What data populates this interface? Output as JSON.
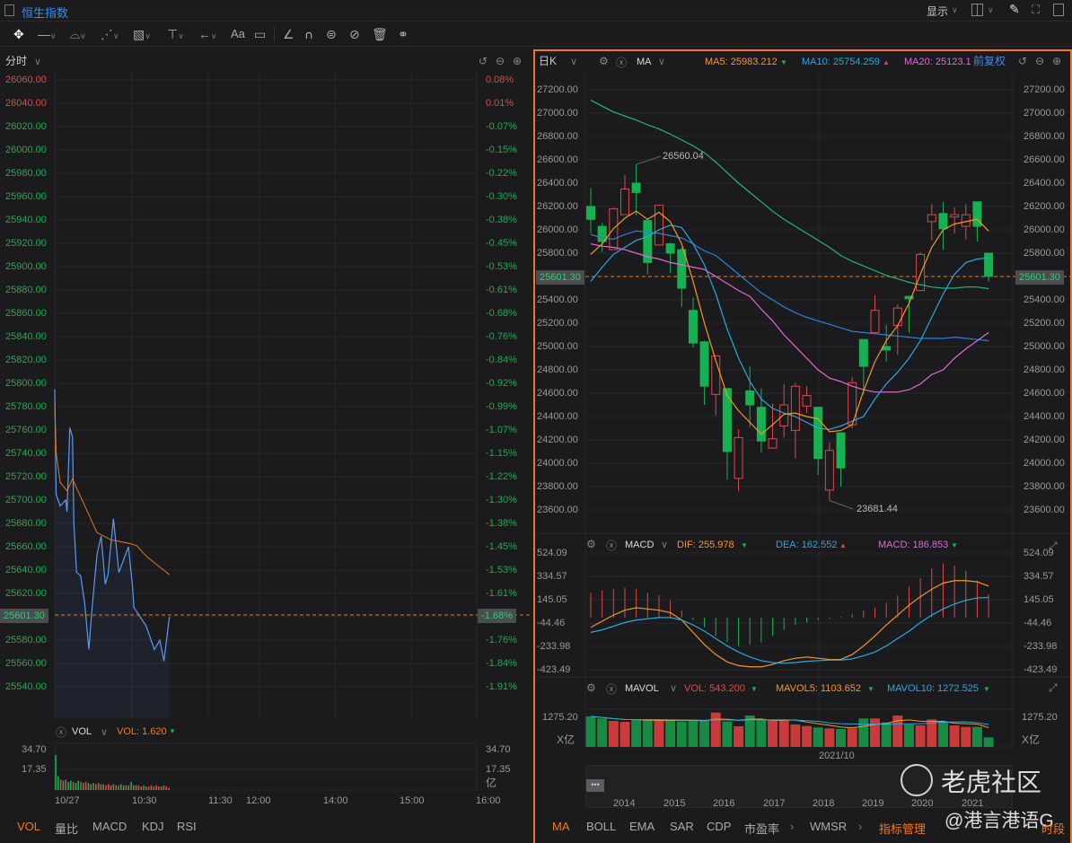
{
  "header": {
    "title": "恒生指数",
    "display_label": "显示"
  },
  "toolbar": {
    "text_tool": "Aa"
  },
  "left": {
    "period": "分时",
    "price_labels": [
      "26060.00",
      "26040.00",
      "26020.00",
      "26000.00",
      "25980.00",
      "25960.00",
      "25940.00",
      "25920.00",
      "25900.00",
      "25880.00",
      "25860.00",
      "25840.00",
      "25820.00",
      "25800.00",
      "25780.00",
      "25760.00",
      "25740.00",
      "25720.00",
      "25700.00",
      "25680.00",
      "25660.00",
      "25640.00",
      "25620.00",
      "",
      "25580.00",
      "25560.00",
      "25540.00"
    ],
    "pct_labels": [
      "0.08%",
      "0.01%",
      "-0.07%",
      "-0.15%",
      "-0.22%",
      "-0.30%",
      "-0.38%",
      "-0.45%",
      "-0.53%",
      "-0.61%",
      "-0.68%",
      "-0.76%",
      "-0.84%",
      "-0.92%",
      "-0.99%",
      "-1.07%",
      "-1.15%",
      "-1.22%",
      "-1.30%",
      "-1.38%",
      "-1.45%",
      "-1.53%",
      "-1.61%",
      "",
      "-1.76%",
      "-1.84%",
      "-1.91%"
    ],
    "current_price": "25601.30",
    "current_pct": "-1.68%",
    "vol_indicator": "VOL",
    "vol_value": "VOL: 1.620",
    "vol_axis": [
      "34.70",
      "17.35"
    ],
    "vol_unit": "亿",
    "time_labels": [
      "10/27",
      "10:30",
      "11:30",
      "12:00",
      "14:00",
      "15:00",
      "16:00"
    ],
    "tabs": [
      "VOL",
      "量比",
      "MACD",
      "KDJ",
      "RSI"
    ],
    "intraday": {
      "minutes": [
        0,
        1,
        4,
        8,
        9,
        11,
        13,
        14,
        16,
        19,
        22,
        25,
        27,
        31,
        34,
        37,
        39,
        43,
        47,
        54,
        57,
        58,
        67,
        73,
        77,
        80,
        84
      ],
      "price": [
        25795,
        25705,
        25695,
        25700,
        25690,
        25762,
        25754,
        25680,
        25638,
        25635,
        25611,
        25572,
        25603,
        25654,
        25669,
        25628,
        25636,
        25684,
        25638,
        25660,
        25626,
        25608,
        25592,
        25572,
        25580,
        25562,
        25600
      ],
      "avg_minutes": [
        0,
        1,
        4,
        9,
        13,
        31,
        41,
        54,
        60,
        67,
        84
      ],
      "avg": [
        25782,
        25741,
        25715,
        25708,
        25718,
        25672,
        25666,
        25663,
        25661,
        25652,
        25636
      ],
      "volume": [
        30,
        12,
        9,
        8,
        9,
        7,
        8,
        7,
        6,
        8,
        7,
        6,
        7,
        6,
        5,
        6,
        5,
        6,
        5,
        5,
        4,
        5,
        4,
        5,
        4,
        4,
        5,
        4,
        4,
        4,
        7,
        4,
        4,
        4,
        3,
        4,
        3,
        3,
        4,
        3,
        4,
        3,
        3,
        4,
        3,
        2
      ],
      "volume_colors": [
        "g",
        "g",
        "r",
        "g",
        "r",
        "g",
        "g",
        "r",
        "g",
        "g",
        "g",
        "r",
        "r",
        "g",
        "r",
        "g",
        "r",
        "r",
        "g",
        "r",
        "r",
        "r",
        "g",
        "r",
        "g",
        "r",
        "g",
        "g",
        "r",
        "g",
        "g",
        "r",
        "g",
        "r",
        "r",
        "g",
        "r",
        "r",
        "r",
        "g",
        "r",
        "r",
        "g",
        "r",
        "r",
        "r"
      ]
    }
  },
  "right": {
    "period": "日K",
    "indicator": "MA",
    "ma5": "MA5: 25983.212",
    "ma10": "MA10: 25754.259",
    "ma20": "MA20: 25123.1",
    "adjust": "前复权",
    "price_labels": [
      "27200.00",
      "27000.00",
      "26800.00",
      "26600.00",
      "26400.00",
      "26200.00",
      "26000.00",
      "25800.00",
      "",
      "25400.00",
      "25200.00",
      "25000.00",
      "24800.00",
      "24600.00",
      "24400.00",
      "24200.00",
      "24000.00",
      "23800.00",
      "23600.00"
    ],
    "current_price": "25601.30",
    "high_label": "26560.04",
    "low_label": "23681.44",
    "macd": {
      "name": "MACD",
      "dif": "DIF: 255.978",
      "dea": "DEA: 162.552",
      "macd": "MACD: 186.853",
      "axis": [
        "524.09",
        "334.57",
        "145.05",
        "-44.46",
        "-233.98",
        "-423.49"
      ]
    },
    "mavol": {
      "name": "MAVOL",
      "vol": "VOL: 543.200",
      "mavol5": "MAVOL5: 1103.652",
      "mavol10": "MAVOL10: 1272.525",
      "axis": "1275.20",
      "unit": "X亿",
      "date": "2021/10"
    },
    "years": [
      "2014",
      "2015",
      "2016",
      "2017",
      "2018",
      "2019",
      "2020",
      "2021"
    ],
    "tabs": [
      "MA",
      "BOLL",
      "EMA",
      "SAR",
      "CDP",
      "市盈率",
      "WMSR",
      "指标管理",
      "时段"
    ],
    "watermark": "老虎社区",
    "watermark2": "@港言港语G"
  },
  "colors": {
    "up": "#e0484a",
    "down": "#16b150",
    "accent": "#f07a1a",
    "ma5": "#f5962a",
    "ma10": "#29a8e0",
    "ma20": "#e06ad4",
    "ma_blue": "#2c7fe0",
    "ma_green": "#22b67a",
    "link": "#3d8bf0"
  },
  "chart_data": {
    "type": "candlestick",
    "ohlc": [
      [
        26200,
        26090,
        26360,
        25970
      ],
      [
        26030,
        25900,
        26060,
        25810
      ],
      [
        25830,
        26180,
        26190,
        25830
      ],
      [
        26130,
        26350,
        26470,
        26130
      ],
      [
        26400,
        26320,
        26560.04,
        26120
      ],
      [
        26080,
        25720,
        26100,
        25620
      ],
      [
        25870,
        26210,
        26210,
        25870
      ],
      [
        25880,
        25800,
        25890,
        25630
      ],
      [
        25830,
        25500,
        25850,
        25340
      ],
      [
        25310,
        25030,
        25420,
        24990
      ],
      [
        25040,
        24660,
        25050,
        24500
      ],
      [
        24590,
        24920,
        24920,
        24410
      ],
      [
        24640,
        24100,
        24640,
        23860
      ],
      [
        23870,
        24220,
        24290,
        23760
      ],
      [
        24620,
        24500,
        24830,
        24310
      ],
      [
        24480,
        24190,
        24640,
        24090
      ],
      [
        24130,
        24210,
        24510,
        24130
      ],
      [
        24320,
        24500,
        24680,
        24220
      ],
      [
        24280,
        24660,
        24690,
        24040
      ],
      [
        24490,
        24580,
        24660,
        24430
      ],
      [
        24480,
        24040,
        24480,
        23900
      ],
      [
        23770,
        24110,
        24180,
        23681.44
      ],
      [
        24260,
        23960,
        24260,
        23800
      ],
      [
        24330,
        24690,
        24740,
        24300
      ],
      [
        25060,
        24830,
        25060,
        24590
      ],
      [
        25120,
        25310,
        25440,
        25120
      ],
      [
        25000,
        24970,
        25190,
        24870
      ],
      [
        25180,
        25330,
        25360,
        24930
      ],
      [
        25430,
        25410,
        25430,
        25120
      ],
      [
        25480,
        25790,
        25810,
        25480
      ],
      [
        26070,
        26130,
        26220,
        25910
      ],
      [
        26140,
        26010,
        26240,
        25830
      ],
      [
        26110,
        26130,
        26190,
        25970
      ],
      [
        26030,
        26130,
        26220,
        25920
      ],
      [
        26240,
        26030,
        26240,
        25900
      ],
      [
        25800,
        25601.3,
        25800,
        25560
      ]
    ],
    "ma5": [
      25790,
      25880,
      26010,
      26100,
      26160,
      26090,
      26150,
      26070,
      25880,
      25560,
      25200,
      24880,
      24580,
      24450,
      24350,
      24250,
      24330,
      24420,
      24430,
      24400,
      24380,
      24270,
      24280,
      24330,
      24620,
      24870,
      25050,
      25180,
      25370,
      25620,
      25850,
      26000,
      26050,
      26070,
      26090,
      25990
    ],
    "ma10": [
      25560,
      25680,
      25790,
      25850,
      25910,
      25940,
      26000,
      26040,
      26020,
      25880,
      25700,
      25450,
      25150,
      24900,
      24700,
      24550,
      24470,
      24430,
      24400,
      24350,
      24300,
      24290,
      24320,
      24360,
      24400,
      24550,
      24680,
      24780,
      24900,
      25050,
      25250,
      25450,
      25620,
      25720,
      25750,
      25760
    ],
    "ma20": [
      25880,
      25860,
      25850,
      25830,
      25800,
      25770,
      25750,
      25720,
      25700,
      25680,
      25660,
      25600,
      25540,
      25480,
      25430,
      25320,
      25220,
      25100,
      25000,
      24900,
      24800,
      24730,
      24700,
      24660,
      24630,
      24610,
      24610,
      24610,
      24630,
      24680,
      24760,
      24800,
      24900,
      24980,
      25050,
      25120
    ],
    "ma_blue": [
      25960,
      25930,
      25920,
      25960,
      25990,
      25980,
      25970,
      25950,
      25930,
      25880,
      25820,
      25780,
      25700,
      25620,
      25540,
      25460,
      25400,
      25340,
      25290,
      25250,
      25220,
      25190,
      25160,
      25130,
      25120,
      25110,
      25100,
      25090,
      25080,
      25070,
      25070,
      25070,
      25080,
      25070,
      25060,
      25050
    ],
    "ma_green": [
      27110,
      27060,
      27010,
      26975,
      26940,
      26900,
      26865,
      26820,
      26770,
      26720,
      26660,
      26580,
      26490,
      26400,
      26320,
      26240,
      26160,
      26090,
      26030,
      25970,
      25910,
      25850,
      25780,
      25730,
      25690,
      25650,
      25610,
      25580,
      25550,
      25530,
      25510,
      25500,
      25500,
      25510,
      25510,
      25495
    ],
    "ylim": [
      23500,
      27300
    ],
    "macd_hist": [
      200,
      220,
      230,
      240,
      230,
      200,
      180,
      140,
      60,
      -20,
      -80,
      -150,
      -200,
      -230,
      -220,
      -200,
      -150,
      -100,
      -60,
      -40,
      -20,
      -10,
      5,
      30,
      60,
      80,
      120,
      180,
      250,
      320,
      400,
      440,
      420,
      380,
      300,
      187
    ],
    "dif": [
      -80,
      -30,
      20,
      60,
      80,
      70,
      60,
      40,
      -20,
      -120,
      -220,
      -300,
      -360,
      -390,
      -400,
      -400,
      -380,
      -350,
      -330,
      -320,
      -330,
      -340,
      -340,
      -300,
      -230,
      -150,
      -60,
      20,
      100,
      170,
      230,
      280,
      300,
      300,
      290,
      256
    ],
    "dea": [
      -120,
      -100,
      -70,
      -40,
      -20,
      -10,
      0,
      0,
      -20,
      -60,
      -110,
      -170,
      -230,
      -280,
      -320,
      -350,
      -365,
      -370,
      -365,
      -355,
      -350,
      -345,
      -345,
      -335,
      -310,
      -280,
      -230,
      -170,
      -110,
      -40,
      20,
      70,
      110,
      140,
      160,
      163
    ],
    "volume": [
      1307,
      1231,
      1143,
      1110,
      1176,
      1199,
      1166,
      1143,
      1121,
      1166,
      1166,
      1449,
      1121,
      947,
      1340,
      1199,
      1166,
      1166,
      1012,
      957,
      904,
      871,
      848,
      871,
      1231,
      1231,
      1088,
      1340,
      1012,
      979,
      1199,
      1121,
      979,
      924,
      924,
      543
    ],
    "volume_colors": [
      "g",
      "g",
      "r",
      "r",
      "g",
      "g",
      "r",
      "g",
      "g",
      "g",
      "g",
      "r",
      "g",
      "r",
      "g",
      "g",
      "r",
      "r",
      "r",
      "r",
      "g",
      "r",
      "g",
      "r",
      "g",
      "r",
      "g",
      "r",
      "g",
      "r",
      "r",
      "g",
      "r",
      "r",
      "g",
      "g"
    ]
  }
}
